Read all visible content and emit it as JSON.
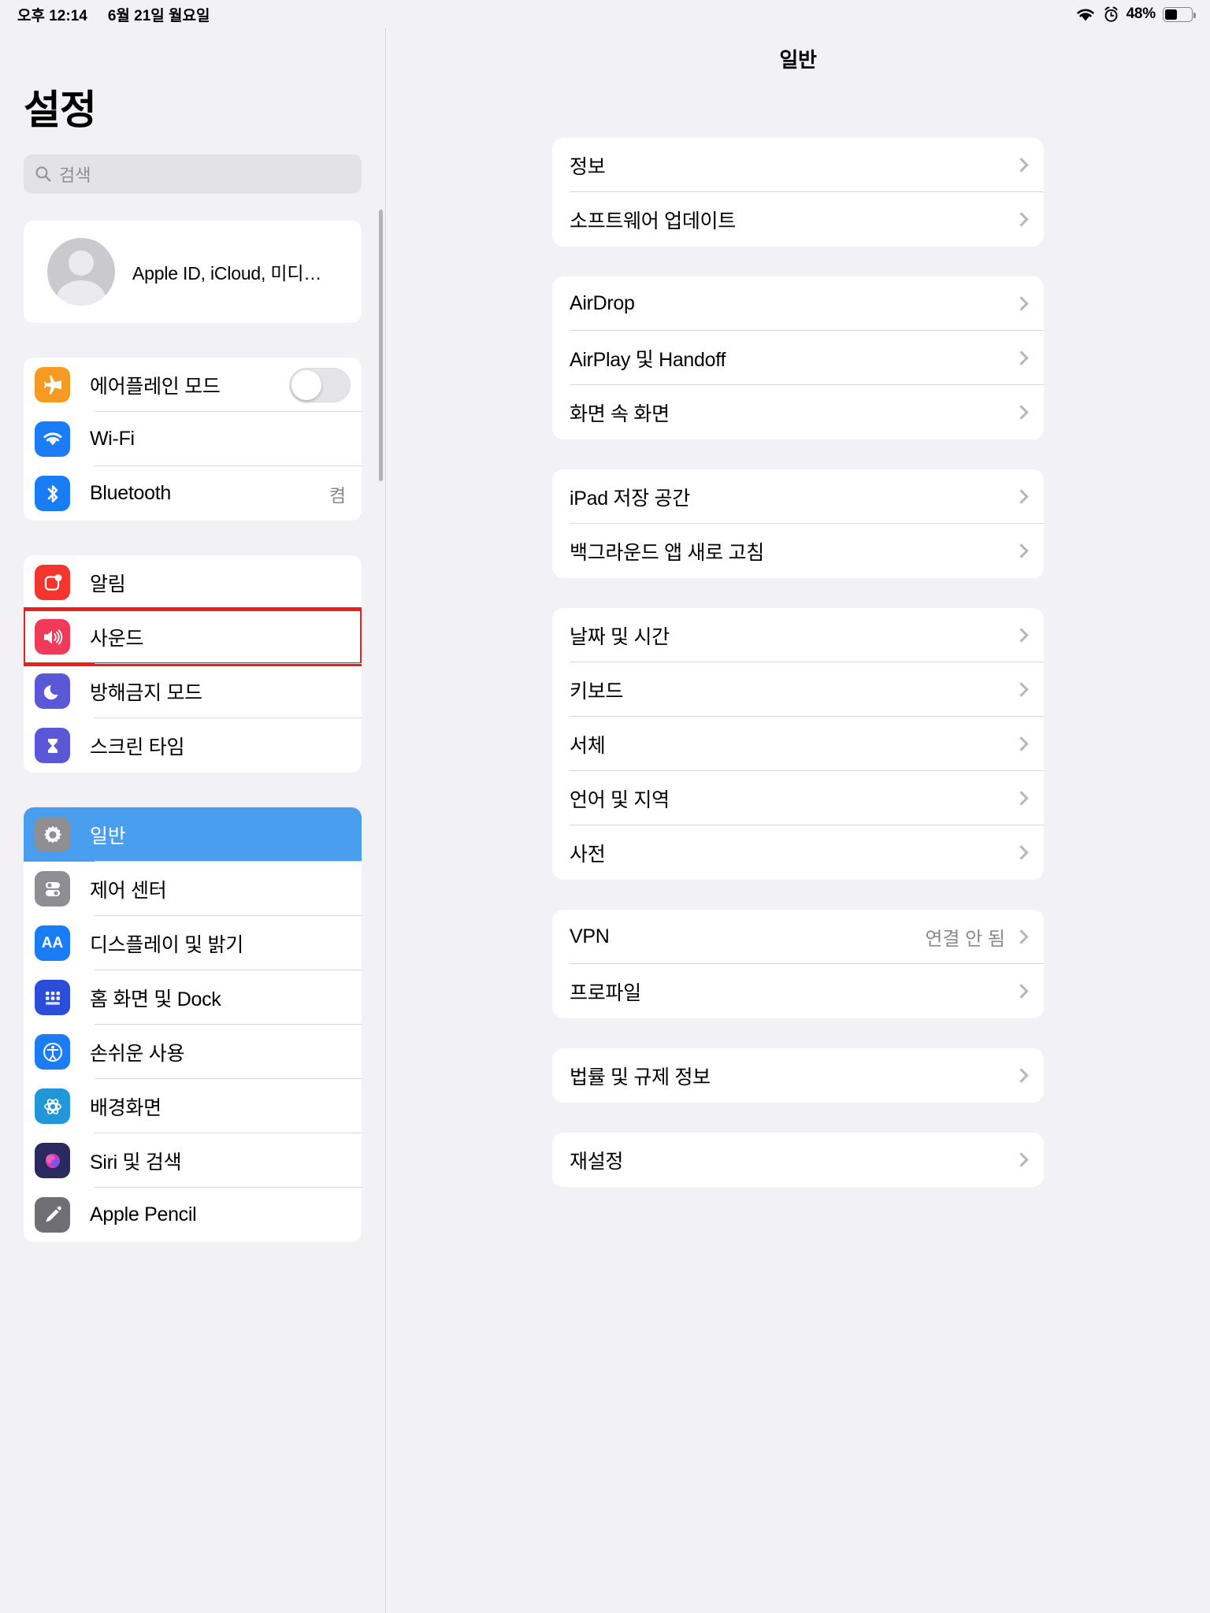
{
  "status_bar": {
    "time": "오후 12:14",
    "date": "6월 21일 월요일",
    "wifi_icon": "wifi-icon",
    "alarm_icon": "alarm-clock-icon",
    "battery_percent": "48%",
    "battery_level": 48
  },
  "sidebar": {
    "title": "설정",
    "search": {
      "placeholder": "검색",
      "icon": "search-icon",
      "value": ""
    },
    "account": {
      "label": "Apple ID, iCloud, 미디어 및...",
      "avatar_icon": "person-avatar-icon"
    },
    "groups": [
      {
        "rows": [
          {
            "label": "에어플레인 모드",
            "icon": "airplane-icon",
            "icon_color": "#f59a23",
            "control": "toggle",
            "toggle_on": false
          },
          {
            "label": "Wi-Fi",
            "icon": "wifi-icon",
            "icon_color": "#1b7df5",
            "value": ""
          },
          {
            "label": "Bluetooth",
            "icon": "bluetooth-icon",
            "icon_color": "#1b7df5",
            "value": "켬"
          }
        ]
      },
      {
        "rows": [
          {
            "label": "알림",
            "icon": "notifications-icon",
            "icon_color": "#f5362e"
          },
          {
            "label": "사운드",
            "icon": "sound-speaker-icon",
            "icon_color": "#f03a5a",
            "highlighted": true
          },
          {
            "label": "방해금지 모드",
            "icon": "moon-icon",
            "icon_color": "#5a58d6"
          },
          {
            "label": "스크린 타임",
            "icon": "hourglass-icon",
            "icon_color": "#5a58d6"
          }
        ]
      },
      {
        "rows": [
          {
            "label": "일반",
            "icon": "gear-icon",
            "icon_color": "#8e8e93",
            "selected": true
          },
          {
            "label": "제어 센터",
            "icon": "control-center-icon",
            "icon_color": "#8e8e93"
          },
          {
            "label": "디스플레이 및 밝기",
            "icon": "display-aa-icon",
            "icon_color": "#1b7df5"
          },
          {
            "label": "홈 화면 및 Dock",
            "icon": "home-screen-icon",
            "icon_color": "#2b4ed8"
          },
          {
            "label": "손쉬운 사용",
            "icon": "accessibility-icon",
            "icon_color": "#1b7df5"
          },
          {
            "label": "배경화면",
            "icon": "wallpaper-icon",
            "icon_color": "#2196d8"
          },
          {
            "label": "Siri 및 검색",
            "icon": "siri-icon",
            "icon_color": "#2a2a5e"
          },
          {
            "label": "Apple Pencil",
            "icon": "pencil-icon",
            "icon_color": "#6e6e73"
          }
        ]
      }
    ]
  },
  "detail": {
    "title": "일반",
    "groups": [
      {
        "rows": [
          {
            "label": "정보",
            "accessory": "chevron"
          },
          {
            "label": "소프트웨어 업데이트",
            "accessory": "chevron"
          }
        ]
      },
      {
        "rows": [
          {
            "label": "AirDrop",
            "accessory": "chevron"
          },
          {
            "label": "AirPlay 및 Handoff",
            "accessory": "chevron"
          },
          {
            "label": "화면 속 화면",
            "accessory": "chevron"
          }
        ]
      },
      {
        "rows": [
          {
            "label": "iPad 저장 공간",
            "accessory": "chevron"
          },
          {
            "label": "백그라운드 앱 새로 고침",
            "accessory": "chevron"
          }
        ]
      },
      {
        "rows": [
          {
            "label": "날짜 및 시간",
            "accessory": "chevron"
          },
          {
            "label": "키보드",
            "accessory": "chevron"
          },
          {
            "label": "서체",
            "accessory": "chevron"
          },
          {
            "label": "언어 및 지역",
            "accessory": "chevron"
          },
          {
            "label": "사전",
            "accessory": "chevron"
          }
        ]
      },
      {
        "rows": [
          {
            "label": "VPN",
            "value": "연결 안 됨",
            "accessory": "chevron"
          },
          {
            "label": "프로파일",
            "accessory": "chevron"
          }
        ]
      },
      {
        "rows": [
          {
            "label": "법률 및 규제 정보",
            "accessory": "chevron"
          }
        ]
      },
      {
        "rows": [
          {
            "label": "재설정",
            "accessory": "chevron"
          }
        ]
      }
    ]
  },
  "colors": {
    "accent_blue": "#4a9ef0",
    "highlight_red": "#e8201e",
    "page_bg": "#f2f1f6",
    "card_bg": "#ffffff"
  }
}
